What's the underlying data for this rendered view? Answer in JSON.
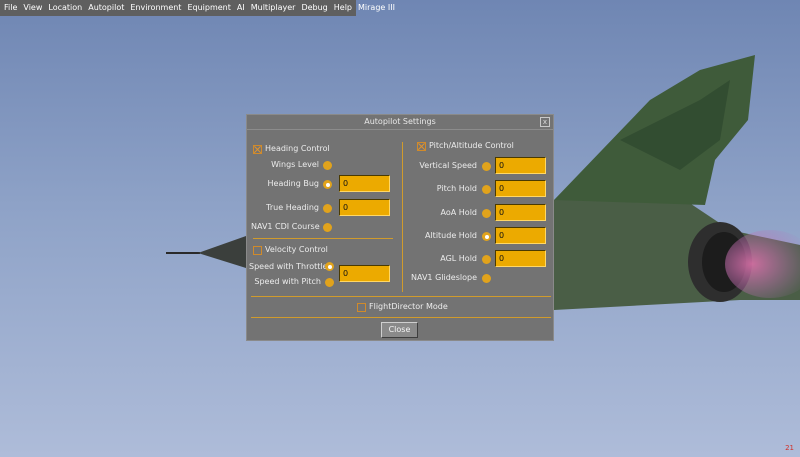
{
  "menu": [
    "File",
    "View",
    "Location",
    "Autopilot",
    "Environment",
    "Equipment",
    "AI",
    "Multiplayer",
    "Debug",
    "Help",
    "Mirage III"
  ],
  "dialog": {
    "title": "Autopilot Settings",
    "close_x": "x",
    "heading": {
      "label": "Heading Control",
      "checked": true,
      "wings_level": "Wings Level",
      "heading_bug": "Heading Bug",
      "heading_bug_value": "0",
      "true_heading": "True Heading",
      "true_heading_value": "0",
      "nav1_cdi": "NAV1 CDI Course",
      "selected": "Heading Bug"
    },
    "velocity": {
      "label": "Velocity Control",
      "checked": false,
      "throttle": "Speed with Throttle",
      "throttle_value": "0",
      "pitch": "Speed with Pitch",
      "selected": "Speed with Throttle"
    },
    "pitch_alt": {
      "label": "Pitch/Altitude Control",
      "checked": true,
      "vertical_speed": "Vertical Speed",
      "vertical_speed_value": "0",
      "pitch_hold": "Pitch Hold",
      "pitch_hold_value": "0",
      "aoa_hold": "AoA Hold",
      "aoa_hold_value": "0",
      "altitude_hold": "Altitude Hold",
      "altitude_hold_value": "0",
      "agl_hold": "AGL Hold",
      "agl_hold_value": "0",
      "nav1_glideslope": "NAV1 Glideslope",
      "selected": "Altitude Hold"
    },
    "flight_director": {
      "label": "FlightDirector Mode",
      "checked": false
    },
    "close_button": "Close"
  },
  "colors": {
    "accent": "#e1a31c",
    "field_bg": "#ecaa00",
    "dialog_bg": "#737373",
    "menubar_bg": "#5f5f5f"
  },
  "fps": "21"
}
